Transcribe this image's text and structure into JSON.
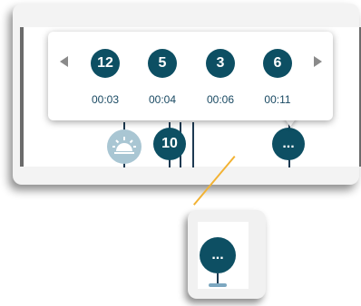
{
  "popover": {
    "items": [
      {
        "count": "12",
        "time": "00:03"
      },
      {
        "count": "5",
        "time": "00:04"
      },
      {
        "count": "3",
        "time": "00:06"
      },
      {
        "count": "6",
        "time": "00:11"
      }
    ],
    "prev_icon": "chevron-left-icon",
    "next_icon": "chevron-right-icon"
  },
  "timeline": {
    "sun_icon": "sunrise-icon",
    "cluster_count": "10",
    "more_label": "..."
  },
  "zoom": {
    "more_label": "..."
  },
  "colors": {
    "marker": "#0d4f63",
    "connector": "#f2b233",
    "sun_marker": "#a9c6d3",
    "time_text": "#1a4a63"
  }
}
